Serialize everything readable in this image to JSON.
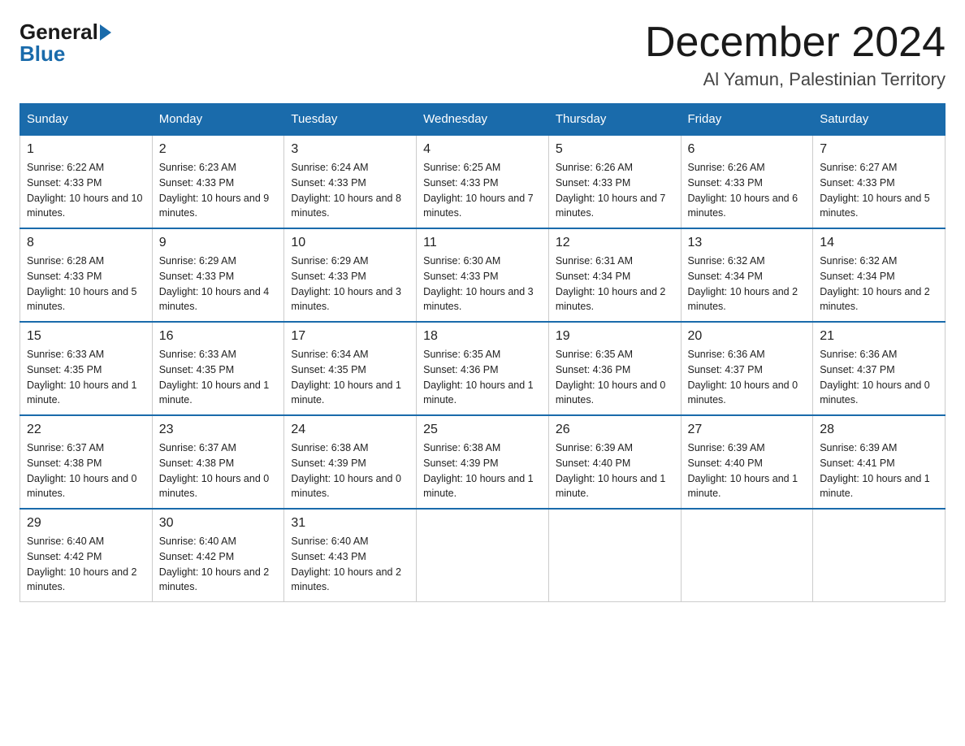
{
  "logo": {
    "general": "General",
    "blue": "Blue"
  },
  "title": "December 2024",
  "location": "Al Yamun, Palestinian Territory",
  "days_of_week": [
    "Sunday",
    "Monday",
    "Tuesday",
    "Wednesday",
    "Thursday",
    "Friday",
    "Saturday"
  ],
  "weeks": [
    [
      {
        "day": "1",
        "sunrise": "6:22 AM",
        "sunset": "4:33 PM",
        "daylight": "10 hours and 10 minutes."
      },
      {
        "day": "2",
        "sunrise": "6:23 AM",
        "sunset": "4:33 PM",
        "daylight": "10 hours and 9 minutes."
      },
      {
        "day": "3",
        "sunrise": "6:24 AM",
        "sunset": "4:33 PM",
        "daylight": "10 hours and 8 minutes."
      },
      {
        "day": "4",
        "sunrise": "6:25 AM",
        "sunset": "4:33 PM",
        "daylight": "10 hours and 7 minutes."
      },
      {
        "day": "5",
        "sunrise": "6:26 AM",
        "sunset": "4:33 PM",
        "daylight": "10 hours and 7 minutes."
      },
      {
        "day": "6",
        "sunrise": "6:26 AM",
        "sunset": "4:33 PM",
        "daylight": "10 hours and 6 minutes."
      },
      {
        "day": "7",
        "sunrise": "6:27 AM",
        "sunset": "4:33 PM",
        "daylight": "10 hours and 5 minutes."
      }
    ],
    [
      {
        "day": "8",
        "sunrise": "6:28 AM",
        "sunset": "4:33 PM",
        "daylight": "10 hours and 5 minutes."
      },
      {
        "day": "9",
        "sunrise": "6:29 AM",
        "sunset": "4:33 PM",
        "daylight": "10 hours and 4 minutes."
      },
      {
        "day": "10",
        "sunrise": "6:29 AM",
        "sunset": "4:33 PM",
        "daylight": "10 hours and 3 minutes."
      },
      {
        "day": "11",
        "sunrise": "6:30 AM",
        "sunset": "4:33 PM",
        "daylight": "10 hours and 3 minutes."
      },
      {
        "day": "12",
        "sunrise": "6:31 AM",
        "sunset": "4:34 PM",
        "daylight": "10 hours and 2 minutes."
      },
      {
        "day": "13",
        "sunrise": "6:32 AM",
        "sunset": "4:34 PM",
        "daylight": "10 hours and 2 minutes."
      },
      {
        "day": "14",
        "sunrise": "6:32 AM",
        "sunset": "4:34 PM",
        "daylight": "10 hours and 2 minutes."
      }
    ],
    [
      {
        "day": "15",
        "sunrise": "6:33 AM",
        "sunset": "4:35 PM",
        "daylight": "10 hours and 1 minute."
      },
      {
        "day": "16",
        "sunrise": "6:33 AM",
        "sunset": "4:35 PM",
        "daylight": "10 hours and 1 minute."
      },
      {
        "day": "17",
        "sunrise": "6:34 AM",
        "sunset": "4:35 PM",
        "daylight": "10 hours and 1 minute."
      },
      {
        "day": "18",
        "sunrise": "6:35 AM",
        "sunset": "4:36 PM",
        "daylight": "10 hours and 1 minute."
      },
      {
        "day": "19",
        "sunrise": "6:35 AM",
        "sunset": "4:36 PM",
        "daylight": "10 hours and 0 minutes."
      },
      {
        "day": "20",
        "sunrise": "6:36 AM",
        "sunset": "4:37 PM",
        "daylight": "10 hours and 0 minutes."
      },
      {
        "day": "21",
        "sunrise": "6:36 AM",
        "sunset": "4:37 PM",
        "daylight": "10 hours and 0 minutes."
      }
    ],
    [
      {
        "day": "22",
        "sunrise": "6:37 AM",
        "sunset": "4:38 PM",
        "daylight": "10 hours and 0 minutes."
      },
      {
        "day": "23",
        "sunrise": "6:37 AM",
        "sunset": "4:38 PM",
        "daylight": "10 hours and 0 minutes."
      },
      {
        "day": "24",
        "sunrise": "6:38 AM",
        "sunset": "4:39 PM",
        "daylight": "10 hours and 0 minutes."
      },
      {
        "day": "25",
        "sunrise": "6:38 AM",
        "sunset": "4:39 PM",
        "daylight": "10 hours and 1 minute."
      },
      {
        "day": "26",
        "sunrise": "6:39 AM",
        "sunset": "4:40 PM",
        "daylight": "10 hours and 1 minute."
      },
      {
        "day": "27",
        "sunrise": "6:39 AM",
        "sunset": "4:40 PM",
        "daylight": "10 hours and 1 minute."
      },
      {
        "day": "28",
        "sunrise": "6:39 AM",
        "sunset": "4:41 PM",
        "daylight": "10 hours and 1 minute."
      }
    ],
    [
      {
        "day": "29",
        "sunrise": "6:40 AM",
        "sunset": "4:42 PM",
        "daylight": "10 hours and 2 minutes."
      },
      {
        "day": "30",
        "sunrise": "6:40 AM",
        "sunset": "4:42 PM",
        "daylight": "10 hours and 2 minutes."
      },
      {
        "day": "31",
        "sunrise": "6:40 AM",
        "sunset": "4:43 PM",
        "daylight": "10 hours and 2 minutes."
      },
      null,
      null,
      null,
      null
    ]
  ]
}
